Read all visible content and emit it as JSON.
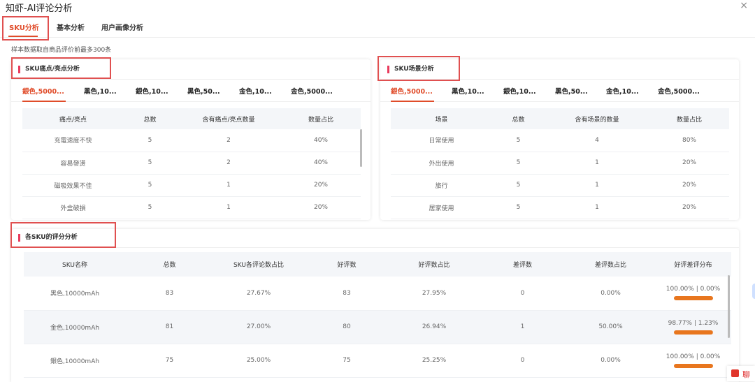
{
  "window": {
    "title": "知虾-AI评论分析",
    "close_label": "×"
  },
  "tabs": [
    {
      "label": "SKU分析"
    },
    {
      "label": "基本分析"
    },
    {
      "label": "用户画像分析"
    }
  ],
  "note": "样本数据取自商品评价前最多300条",
  "pain_card": {
    "title": "SKU痛点/亮点分析",
    "sku_tabs": [
      "銀色,5000...",
      "黑色,10...",
      "銀色,10...",
      "黑色,50...",
      "金色,10...",
      "金色,5000..."
    ],
    "headers": [
      "痛点/亮点",
      "总数",
      "含有痛点/亮点数量",
      "数量占比"
    ],
    "rows": [
      [
        "充電速度不快",
        "5",
        "2",
        "40%"
      ],
      [
        "容易發燙",
        "5",
        "2",
        "40%"
      ],
      [
        "磁吸效果不佳",
        "5",
        "1",
        "20%"
      ],
      [
        "外盒破損",
        "5",
        "1",
        "20%"
      ]
    ]
  },
  "scene_card": {
    "title": "SKU场景分析",
    "sku_tabs": [
      "銀色,5000...",
      "黑色,10...",
      "銀色,10...",
      "黑色,50...",
      "金色,10...",
      "金色,5000..."
    ],
    "headers": [
      "场景",
      "总数",
      "含有场景的数量",
      "数量占比"
    ],
    "rows": [
      [
        "日常使用",
        "5",
        "4",
        "80%"
      ],
      [
        "外出使用",
        "5",
        "1",
        "20%"
      ],
      [
        "旅行",
        "5",
        "1",
        "20%"
      ],
      [
        "居家使用",
        "5",
        "1",
        "20%"
      ]
    ]
  },
  "rating_card": {
    "title": "各SKU的评分分析",
    "headers": [
      "SKU名称",
      "总数",
      "SKU各评论数占比",
      "好评数",
      "好评数占比",
      "差评数",
      "差评数占比",
      "好评差评分布"
    ],
    "rows": [
      {
        "name": "黑色,10000mAh",
        "total": "83",
        "share": "27.67%",
        "good": "83",
        "good_pct": "27.95%",
        "bad": "0",
        "bad_pct": "0.00%",
        "dist": "100.00% | 0.00%",
        "good_ratio": 1.0
      },
      {
        "name": "金色,10000mAh",
        "total": "81",
        "share": "27.00%",
        "good": "80",
        "good_pct": "26.94%",
        "bad": "1",
        "bad_pct": "50.00%",
        "dist": "98.77% | 1.23%",
        "good_ratio": 0.9877
      },
      {
        "name": "銀色,10000mAh",
        "total": "75",
        "share": "25.00%",
        "good": "75",
        "good_pct": "25.25%",
        "bad": "0",
        "bad_pct": "0.00%",
        "dist": "100.00% | 0.00%",
        "good_ratio": 1.0
      }
    ]
  },
  "chat": {
    "label": "聊"
  },
  "colors": {
    "accent": "#e04c2a",
    "title_bar": "#e93a5c",
    "dist_bar": "#e8761e",
    "annotation_box": "#e05050"
  }
}
